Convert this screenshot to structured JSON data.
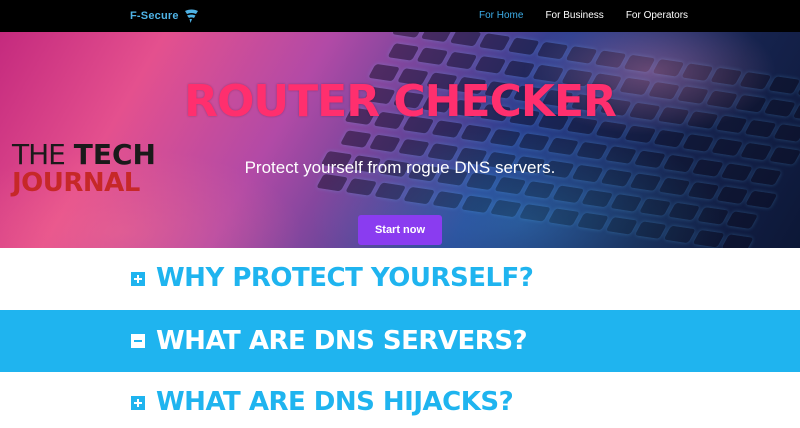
{
  "nav": {
    "brand": "F-Secure",
    "links": [
      {
        "label": "For Home"
      },
      {
        "label": "For Business"
      },
      {
        "label": "For Operators"
      }
    ]
  },
  "hero": {
    "title": "ROUTER CHECKER",
    "subtitle": "Protect yourself from rogue DNS servers.",
    "cta": "Start now"
  },
  "watermark": {
    "line1_a": "THE",
    "line1_b": "TECH",
    "line2": "JOURNAL"
  },
  "sections": [
    {
      "title": "WHY PROTECT YOURSELF?",
      "expanded": false
    },
    {
      "title": "WHAT ARE DNS SERVERS?",
      "expanded": true
    },
    {
      "title": "WHAT ARE DNS HIJACKS?",
      "expanded": false
    }
  ],
  "colors": {
    "accent_blue": "#1fb4ef",
    "title_pink": "#ff2f6e",
    "cta_purple": "#8a3cf0",
    "nav_active": "#3daee9"
  }
}
